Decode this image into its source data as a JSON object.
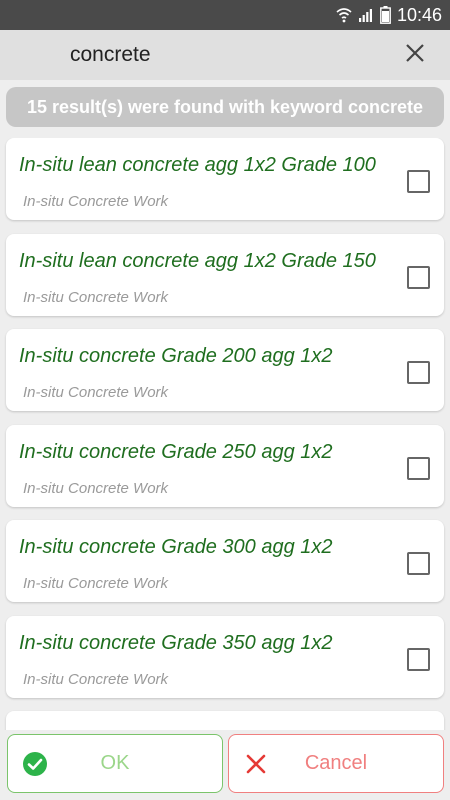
{
  "status_bar": {
    "time": "10:46",
    "icons": [
      "wifi-icon",
      "signal-icon",
      "battery-icon"
    ]
  },
  "search": {
    "value": "concrete",
    "clear_icon": "close-icon"
  },
  "results_banner": "15 result(s) were found with keyword concrete",
  "items": [
    {
      "title": "In-situ lean concrete agg 1x2 Grade 100",
      "category": "In-situ Concrete Work",
      "checked": false
    },
    {
      "title": "In-situ lean concrete agg 1x2 Grade 150",
      "category": "In-situ Concrete Work",
      "checked": false
    },
    {
      "title": "In-situ concrete Grade 200 agg 1x2",
      "category": "In-situ Concrete Work",
      "checked": false
    },
    {
      "title": "In-situ concrete Grade 250 agg 1x2",
      "category": "In-situ Concrete Work",
      "checked": false
    },
    {
      "title": "In-situ concrete Grade 300 agg 1x2",
      "category": "In-situ Concrete Work",
      "checked": false
    },
    {
      "title": "In-situ concrete Grade 350 agg 1x2",
      "category": "In-situ Concrete Work",
      "checked": false
    }
  ],
  "buttons": {
    "ok_label": "OK",
    "cancel_label": "Cancel",
    "ok_icon": "check-circle-icon",
    "cancel_icon": "x-icon"
  },
  "colors": {
    "title_green": "#1f6e1f",
    "ok_green": "#2db34a",
    "cancel_red": "#e53935",
    "banner_gray": "#c6c6c6"
  }
}
